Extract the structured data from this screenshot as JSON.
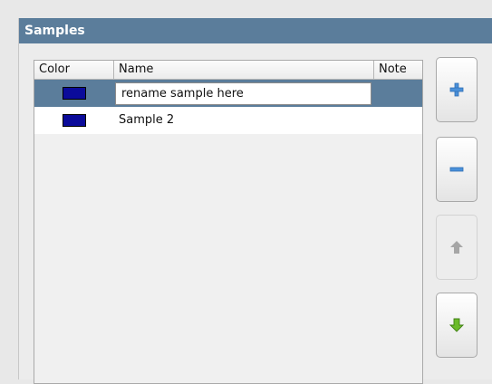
{
  "panel": {
    "title": "Samples"
  },
  "table": {
    "columns": [
      "Color",
      "Name",
      "Note"
    ],
    "rows": [
      {
        "color": "#0b0b9a",
        "name": "rename sample here",
        "note": "",
        "selected": true,
        "editing": true
      },
      {
        "color": "#0b0b9a",
        "name": "Sample 2",
        "note": "",
        "selected": false,
        "editing": false
      }
    ]
  },
  "buttons": [
    {
      "icon": "plus-icon",
      "enabled": true
    },
    {
      "icon": "minus-icon",
      "enabled": true
    },
    {
      "icon": "arrow-up-icon",
      "enabled": false
    },
    {
      "icon": "arrow-down-icon",
      "enabled": true
    }
  ],
  "colors": {
    "header": "#5b7d9b",
    "selection": "#5b7d9b",
    "swatch": "#0b0b9a",
    "plus_minus": "#4a90d9",
    "down_arrow": "#6cbb2a",
    "disabled_arrow": "#a6a6a6"
  }
}
